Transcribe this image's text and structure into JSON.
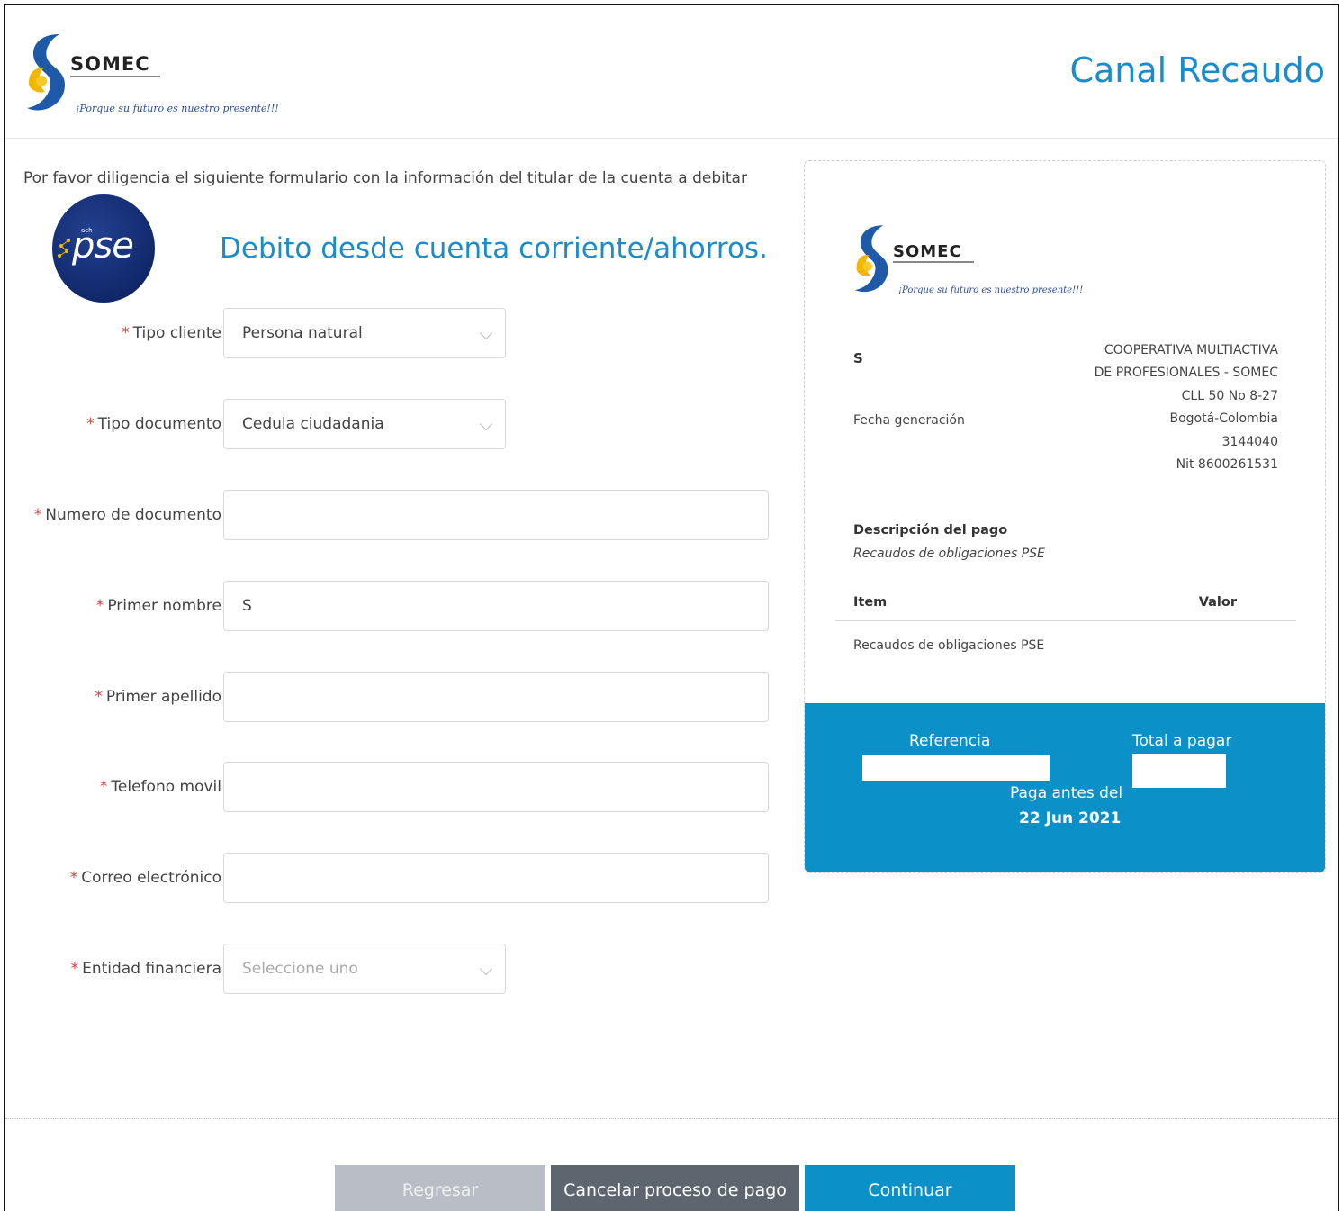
{
  "header": {
    "logo_name": "SOMEC",
    "logo_tagline": "¡Porque su futuro es nuestro presente!!!",
    "title": "Canal Recaudo"
  },
  "form": {
    "intro": "Por favor diligencia el siguiente formulario con la información del titular de la cuenta a debitar",
    "pse_logo_text": "pse",
    "pse_logo_small": "ach",
    "heading": "Debito desde cuenta corriente/ahorros.",
    "required_mark": "*",
    "fields": {
      "tipo_cliente": {
        "label": "Tipo cliente",
        "value": "Persona natural"
      },
      "tipo_documento": {
        "label": "Tipo documento",
        "value": "Cedula ciudadania"
      },
      "numero_documento": {
        "label": "Numero de documento",
        "value": ""
      },
      "primer_nombre": {
        "label": "Primer nombre",
        "value": "S"
      },
      "primer_apellido": {
        "label": "Primer apellido",
        "value": ""
      },
      "telefono_movil": {
        "label": "Telefono movil",
        "value": ""
      },
      "correo": {
        "label": "Correo electrónico",
        "value": ""
      },
      "entidad": {
        "label": "Entidad financiera",
        "placeholder": "Seleccione uno"
      }
    }
  },
  "receipt": {
    "logo_name": "SOMEC",
    "logo_tagline": "¡Porque su futuro es nuestro presente!!!",
    "customer_name": "S",
    "fecha_label": "Fecha generación",
    "company_lines": [
      "COOPERATIVA MULTIACTIVA",
      "DE PROFESIONALES - SOMEC",
      "CLL 50 No 8-27",
      "Bogotá-Colombia",
      "3144040",
      "Nit 8600261531"
    ],
    "descripcion_title": "Descripción del pago",
    "descripcion_value": "Recaudos de obligaciones PSE",
    "table": {
      "col_item": "Item",
      "col_valor": "Valor",
      "row_item": "Recaudos de obligaciones PSE"
    },
    "footer": {
      "referencia_label": "Referencia",
      "total_label": "Total a pagar",
      "paga_antes_label": "Paga antes del",
      "fecha_limite": "22 Jun 2021"
    }
  },
  "buttons": {
    "back": "Regresar",
    "cancel": "Cancelar proceso de pago",
    "next": "Continuar"
  },
  "colors": {
    "accent": "#1a8ccb",
    "primary_button": "#0b90c8",
    "cancel_button": "#5d666f",
    "disabled_button": "#b9bec5",
    "required": "#e2393b"
  }
}
